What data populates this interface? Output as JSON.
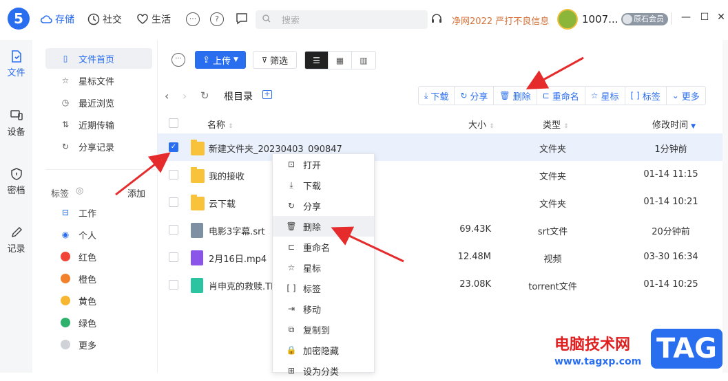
{
  "topbar": {
    "logo": "5",
    "nav": [
      {
        "label": "存储",
        "icon": "cloud-icon"
      },
      {
        "label": "社交",
        "icon": "clock-icon"
      },
      {
        "label": "生活",
        "icon": "heart-icon"
      }
    ],
    "search_placeholder": "搜索",
    "notice": "净网2022 严打不良信息",
    "username": "1007...",
    "vip_label": "原石会员"
  },
  "leftrail": [
    {
      "label": "文件",
      "icon": "file-icon"
    },
    {
      "label": "设备",
      "icon": "device-icon"
    },
    {
      "label": "密档",
      "icon": "shield-icon"
    },
    {
      "label": "记录",
      "icon": "pen-icon"
    }
  ],
  "sidebar": {
    "items": [
      {
        "label": "文件首页",
        "icon": "file-icon"
      },
      {
        "label": "星标文件",
        "icon": "star-icon"
      },
      {
        "label": "最近浏览",
        "icon": "history-icon"
      },
      {
        "label": "近期传输",
        "icon": "transfer-icon"
      },
      {
        "label": "分享记录",
        "icon": "share-icon"
      }
    ],
    "tags_title": "标签",
    "tags_add": "添加",
    "tags": [
      {
        "label": "工作",
        "color": ""
      },
      {
        "label": "个人",
        "color": ""
      },
      {
        "label": "红色",
        "color": "#f04438"
      },
      {
        "label": "橙色",
        "color": "#f2812c"
      },
      {
        "label": "黄色",
        "color": "#f7b733"
      },
      {
        "label": "绿色",
        "color": "#2fb16e"
      },
      {
        "label": "更多",
        "color": "#cfd2d6"
      }
    ]
  },
  "toolbar": {
    "upload": "上传",
    "filter": "筛选"
  },
  "breadcrumb": "根目录",
  "actions": [
    {
      "label": "下载",
      "icon": "download-icon"
    },
    {
      "label": "分享",
      "icon": "share-icon"
    },
    {
      "label": "删除",
      "icon": "trash-icon"
    },
    {
      "label": "重命名",
      "icon": "rename-icon"
    },
    {
      "label": "星标",
      "icon": "star-icon"
    },
    {
      "label": "标签",
      "icon": "tag-icon"
    },
    {
      "label": "更多",
      "icon": "chevron-down-icon"
    }
  ],
  "table": {
    "headers": {
      "name": "名称",
      "size": "大小",
      "type": "类型",
      "modified": "修改时间"
    },
    "rows": [
      {
        "name": "新建文件夹_20230403_090847",
        "size": "",
        "type": "文件夹",
        "modified": "1分钟前",
        "kind": "folder",
        "checked": true
      },
      {
        "name": "我的接收",
        "size": "",
        "type": "文件夹",
        "modified": "01-14 11:15",
        "kind": "folder",
        "checked": false
      },
      {
        "name": "云下载",
        "size": "",
        "type": "文件夹",
        "modified": "01-14 10:21",
        "kind": "folder",
        "checked": false
      },
      {
        "name": "电影3字幕.srt",
        "size": "69.43K",
        "type": "srt文件",
        "modified": "20分钟前",
        "kind": "srt",
        "checked": false
      },
      {
        "name": "2月16日.mp4",
        "size": "12.48M",
        "type": "视频",
        "modified": "03-30 16:34",
        "kind": "video",
        "checked": false
      },
      {
        "name": "肖申克的救赎.Th",
        "size": "23.08K",
        "type": "torrent文件",
        "modified": "01-14 10:25",
        "kind": "torrent",
        "checked": false
      }
    ]
  },
  "context_menu": [
    {
      "label": "打开",
      "icon": "open-icon"
    },
    {
      "label": "下载",
      "icon": "download-icon"
    },
    {
      "label": "分享",
      "icon": "share-icon"
    },
    {
      "label": "删除",
      "icon": "trash-icon"
    },
    {
      "label": "重命名",
      "icon": "rename-icon"
    },
    {
      "label": "星标",
      "icon": "star-icon"
    },
    {
      "label": "标签",
      "icon": "tag-icon"
    },
    {
      "label": "移动",
      "icon": "move-icon"
    },
    {
      "label": "复制到",
      "icon": "copy-icon"
    },
    {
      "label": "加密隐藏",
      "icon": "lock-icon"
    },
    {
      "label": "设为分类",
      "icon": "category-icon"
    }
  ],
  "watermark": {
    "text": "电脑技术网",
    "url": "www.tagxp.com",
    "tag": "TAG"
  }
}
